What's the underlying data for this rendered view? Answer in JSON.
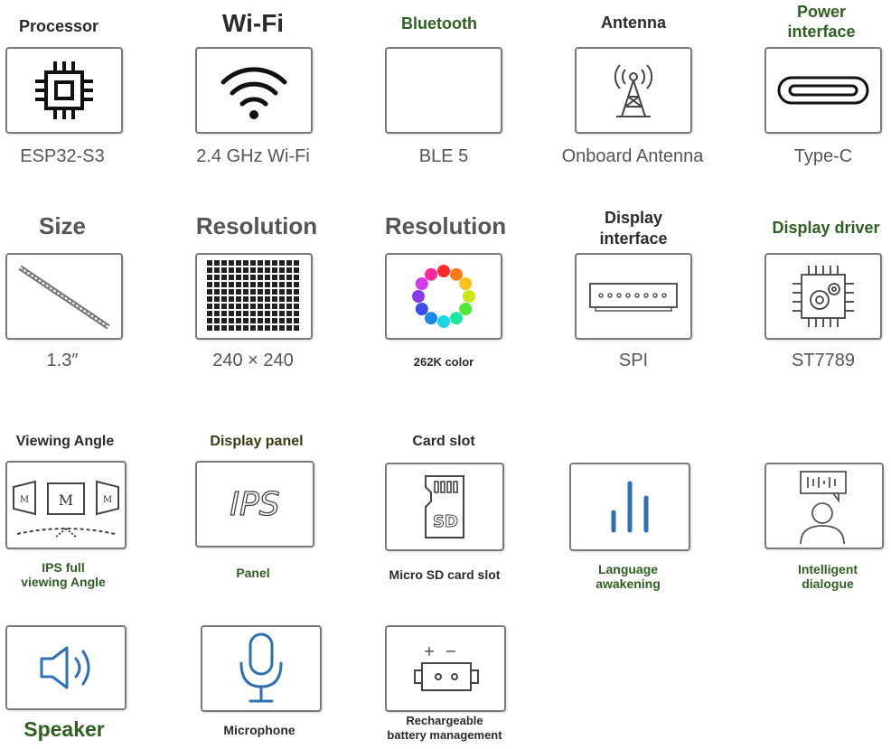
{
  "colors": {
    "border": "#7a7a7a",
    "green_text": "#2e5e22",
    "blue_icon": "#2f6fb3"
  },
  "features": {
    "processor": {
      "title": "Processor",
      "value": "ESP32-S3",
      "icon": "chip-icon"
    },
    "wifi": {
      "title": "Wi-Fi",
      "value": "2.4 GHz Wi-Fi",
      "icon": "wifi-icon"
    },
    "bluetooth": {
      "title": "Bluetooth",
      "value": "BLE 5",
      "icon": ""
    },
    "antenna": {
      "title": "Antenna",
      "value": "Onboard Antenna",
      "icon": "antenna-tower-icon"
    },
    "power": {
      "title_line1": "Power",
      "title_line2": "interface",
      "value": "Type-C",
      "icon": "usb-c-port-icon"
    },
    "size": {
      "title": "Size",
      "value": "1.3″",
      "icon": "screen-diagonal-icon"
    },
    "resolution": {
      "title": "Resolution",
      "value": "240 × 240",
      "icon": "pixel-grid-icon"
    },
    "color": {
      "title": "Resolution",
      "value": "262K color",
      "icon": "color-wheel-icon"
    },
    "display_if": {
      "title_line1": "Display",
      "title_line2": "interface",
      "value": "SPI",
      "icon": "connector-icon"
    },
    "driver": {
      "title": "Display driver",
      "value": "ST7789",
      "icon": "driver-chip-gear-icon"
    },
    "viewing": {
      "title": "Viewing Angle",
      "value_line1": "IPS full",
      "value_line2": "viewing Angle",
      "icon": "viewing-angle-icon",
      "icon_letter": "M"
    },
    "panel": {
      "title": "Display panel",
      "value": "Panel",
      "icon": "ips-icon",
      "icon_text": "IPS"
    },
    "cardslot": {
      "title": "Card slot",
      "value": "Micro SD card slot",
      "icon": "sd-card-icon",
      "icon_text": "SD"
    },
    "language": {
      "value_line1": "Language",
      "value_line2": "awakening",
      "icon": "audio-bars-icon"
    },
    "dialogue": {
      "value_line1": "Intelligent",
      "value_line2": "dialogue",
      "icon": "person-speech-icon"
    },
    "speaker": {
      "title": "Speaker",
      "icon": "speaker-icon"
    },
    "microphone": {
      "title": "Microphone",
      "icon": "microphone-icon"
    },
    "battery": {
      "value_line1": "Rechargeable",
      "value_line2": "battery management",
      "icon": "battery-icon",
      "plus": "+",
      "minus": "−"
    }
  }
}
